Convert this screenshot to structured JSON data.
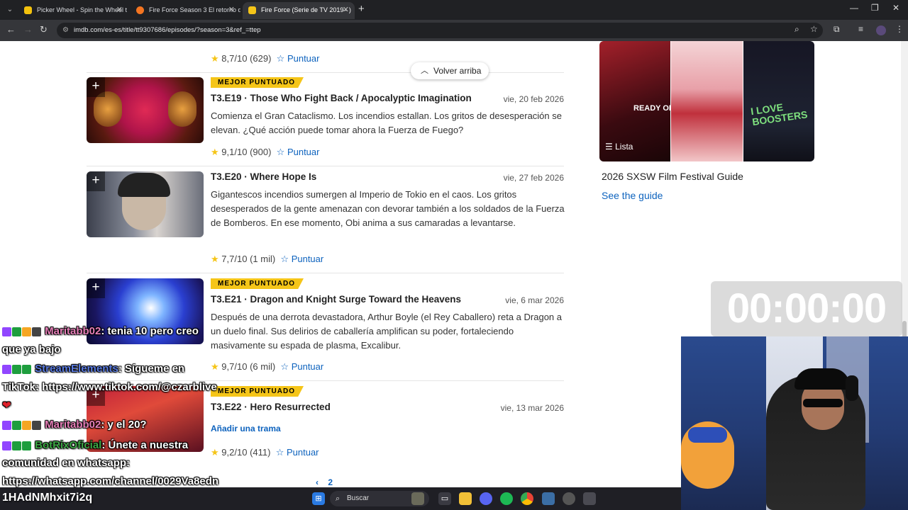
{
  "browser": {
    "tabs": [
      {
        "title": "Picker Wheel - Spin the Wheel t",
        "icon": "picker-wheel-favicon",
        "color": "#f4c20d"
      },
      {
        "title": "Fire Force Season 3 El retorno d",
        "icon": "crunchyroll-favicon",
        "color": "#f47521"
      },
      {
        "title": "Fire Force (Serie de TV 2019– )",
        "icon": "imdb-favicon",
        "color": "#f5c518"
      }
    ],
    "new_tab": "+",
    "url": "imdb.com/es-es/title/tt9307686/episodes/?season=3&ref_=ttep"
  },
  "page": {
    "back_to_top": "Volver arriba",
    "top_rating": {
      "score": "8,7/10",
      "votes": "(629)",
      "rate_label": "Puntuar"
    },
    "badge_text": "MEJOR PUNTUADO",
    "episodes": [
      {
        "badge": "MEJOR PUNTUADO",
        "title": "T3.E19 · Those Who Fight Back / Apocalyptic Imagination",
        "date": "vie, 20 feb 2026",
        "description": "Comienza el Gran Cataclismo. Los incendios estallan. Los gritos de desesperación se elevan. ¿Qué acción puede tomar ahora la Fuerza de Fuego?",
        "score": "9,1/10",
        "votes": "(900)",
        "rate_label": "Puntuar"
      },
      {
        "badge": "",
        "title": "T3.E20 · Where Hope Is",
        "date": "vie, 27 feb 2026",
        "description": "Gigantescos incendios sumergen al Imperio de Tokio en el caos. Los gritos desesperados de la gente amenazan con devorar también a los soldados de la Fuerza de Bomberos. En ese momento, Obi anima a sus camaradas a levantarse.",
        "score": "7,7/10",
        "votes": "(1 mil)",
        "rate_label": "Puntuar"
      },
      {
        "badge": "MEJOR PUNTUADO",
        "title": "T3.E21 · Dragon and Knight Surge Toward the Heavens",
        "date": "vie, 6 mar 2026",
        "description": "Después de una derrota devastadora, Arthur Boyle (el Rey Caballero) reta a Dragon a un duelo final. Sus delirios de caballería amplifican su poder, fortaleciendo masivamente su espada de plasma, Excalibur.",
        "score": "9,7/10",
        "votes": "(6 mil)",
        "rate_label": "Puntuar"
      },
      {
        "badge": "MEJOR PUNTUADO",
        "title": "T3.E22 · Hero Resurrected",
        "date": "vie, 13 mar 2026",
        "add_plot": "Añadir una trama",
        "score": "9,2/10",
        "votes": "(411)",
        "rate_label": "Puntuar"
      }
    ],
    "pagination": {
      "arrow": "‹",
      "page": "2"
    },
    "sidebar": {
      "promo_caption": "Lista",
      "poster1_text": "READY OR NOT",
      "poster3_text": "I LOVE BOOSTERS",
      "title": "2026 SXSW Film Festival Guide",
      "link": "See the guide"
    }
  },
  "overlay": {
    "timer": "00:00:00",
    "chat": [
      {
        "user": "Maritabb02",
        "message": ": tenia 10 pero creo",
        "cont": "que ya bajo",
        "user_color": "#e67fb8"
      },
      {
        "user": "StreamElements",
        "message": ": Sígueme en",
        "cont": "TikTok: https://www.tiktok.com/@czarblive",
        "extra": "❤",
        "user_color": "#5a7be0"
      },
      {
        "user": "Maritabb02",
        "message": ": y el 20?",
        "user_color": "#e67fb8"
      },
      {
        "user": "BotRixOficial",
        "message": ": Únete a nuestra",
        "cont": "comunidad en whatsapp:",
        "cont2": "https://whatsapp.com/channel/0029Va8edn",
        "user_color": "#3da845"
      }
    ],
    "code": "1HAdNMhxit7i2q"
  },
  "taskbar": {
    "search_placeholder": "Buscar"
  }
}
